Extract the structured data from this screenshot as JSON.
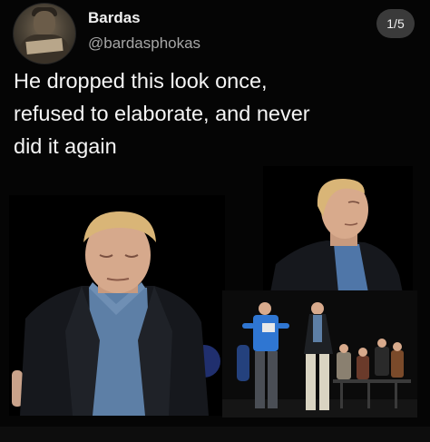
{
  "post": {
    "display_name": "Bardas",
    "handle": "@bardasphokas",
    "counter": "1/5",
    "text_line1": "He dropped this look once,",
    "text_line2": "refused to elaborate, and never",
    "text_line3": "did it again"
  },
  "colors": {
    "background": "#050505",
    "text": "#f5f5f5",
    "handle": "#a6a6a6",
    "counter_pill": "#3a3a3a",
    "shirt_blue": "#5d7fa6",
    "hair_blonde": "#d9b577"
  },
  "images": {
    "main_photo": "man-in-dark-blazer-head-bowed",
    "top_photo": "man-in-dark-blazer-looking-up",
    "stage_photo": "people-on-stage-with-orchestra"
  }
}
